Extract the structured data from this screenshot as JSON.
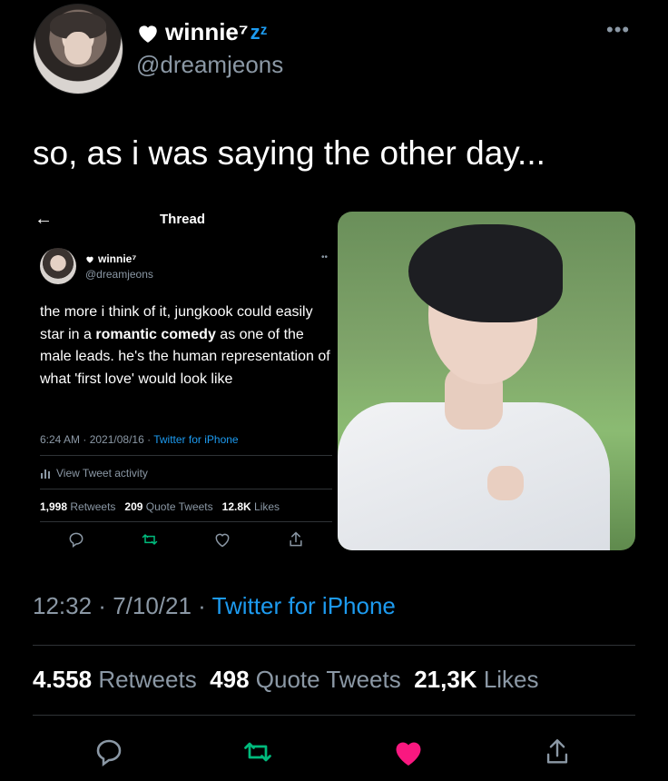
{
  "tweet": {
    "display_name": "winnie⁷",
    "sleep_mark": "zᶻ",
    "handle": "@dreamjeons",
    "text": "so, as i was saying the other day...",
    "time": "12:32",
    "date": "7/10/21",
    "source": "Twitter for iPhone",
    "retweets": "4.558",
    "retweets_label": "Retweets",
    "quotes": "498",
    "quotes_label": "Quote Tweets",
    "likes": "21,3K",
    "likes_label": "Likes",
    "liked": true
  },
  "embedded": {
    "back": "←",
    "title": "Thread",
    "display_name": "winnie⁷",
    "handle": "@dreamjeons",
    "body_before": "the more i think of it, jungkook could easily star in a ",
    "body_bold": "romantic comedy",
    "body_after": " as one of the male leads. he's the human representation of what 'first love' would look like",
    "time": "6:24 AM",
    "date": "2021/08/16",
    "source": "Twitter for iPhone",
    "activity": "View Tweet activity",
    "retweets": "1,998",
    "retweets_label": "Retweets",
    "quotes": "209",
    "quotes_label": "Quote Tweets",
    "likes": "12.8K",
    "likes_label": "Likes"
  },
  "colors": {
    "background": "#000000",
    "muted": "#8b98a5",
    "link": "#1d9bf0",
    "retweet": "#00ba7c",
    "like": "#f91880"
  }
}
